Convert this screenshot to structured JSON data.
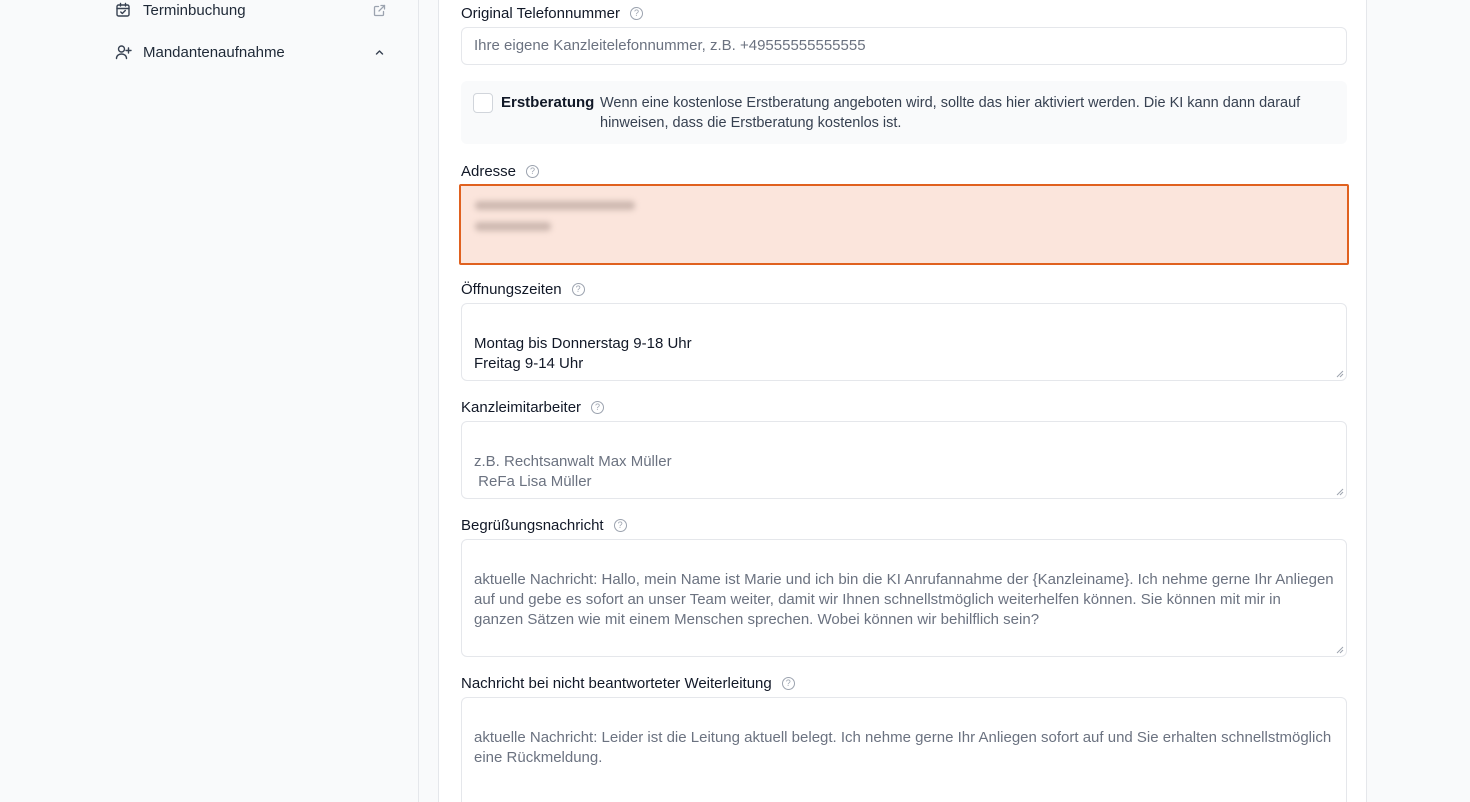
{
  "sidebar": {
    "items": [
      {
        "label": "Terminbuchung",
        "icon": "calendar-check-icon",
        "right_icon": "external-link-icon"
      },
      {
        "label": "Mandantenaufnahme",
        "icon": "user-plus-icon",
        "right_icon": "chevron-up-icon"
      }
    ]
  },
  "form": {
    "phone": {
      "label": "Original Telefonnummer",
      "placeholder": "Ihre eigene Kanzleitelefonnummer, z.B. +49555555555555"
    },
    "erstberatung": {
      "label": "Erstberatung",
      "checked": false,
      "description": "Wenn eine kostenlose Erstberatung angeboten wird, sollte das hier aktiviert werden. Die KI kann dann darauf hinweisen, dass die Erstberatung kostenlos ist."
    },
    "address": {
      "label": "Adresse",
      "state": "error",
      "accent_color": "#e0611f",
      "background_color": "#fbe5dc"
    },
    "hours": {
      "label": "Öffnungszeiten",
      "value": "Montag bis Donnerstag 9-18 Uhr\nFreitag 9-14 Uhr"
    },
    "staff": {
      "label": "Kanzleimitarbeiter",
      "placeholder": "z.B. Rechtsanwalt Max Müller\n ReFa Lisa Müller"
    },
    "greeting": {
      "label": "Begrüßungsnachricht",
      "placeholder": "aktuelle Nachricht: Hallo, mein Name ist Marie und ich bin die KI Anrufannahme der {Kanzleiname}. Ich nehme gerne Ihr Anliegen auf und gebe es sofort an unser Team weiter, damit wir Ihnen schnellstmöglich weiterhelfen können. Sie können mit mir in ganzen Sätzen wie mit einem Menschen sprechen. Wobei können wir behilflich sein?"
    },
    "unanswered": {
      "label": "Nachricht bei nicht beantworteter Weiterleitung",
      "placeholder": "aktuelle Nachricht: Leider ist die Leitung aktuell belegt. Ich nehme gerne Ihr Anliegen sofort auf und Sie erhalten schnellstmöglich eine Rückmeldung."
    }
  }
}
